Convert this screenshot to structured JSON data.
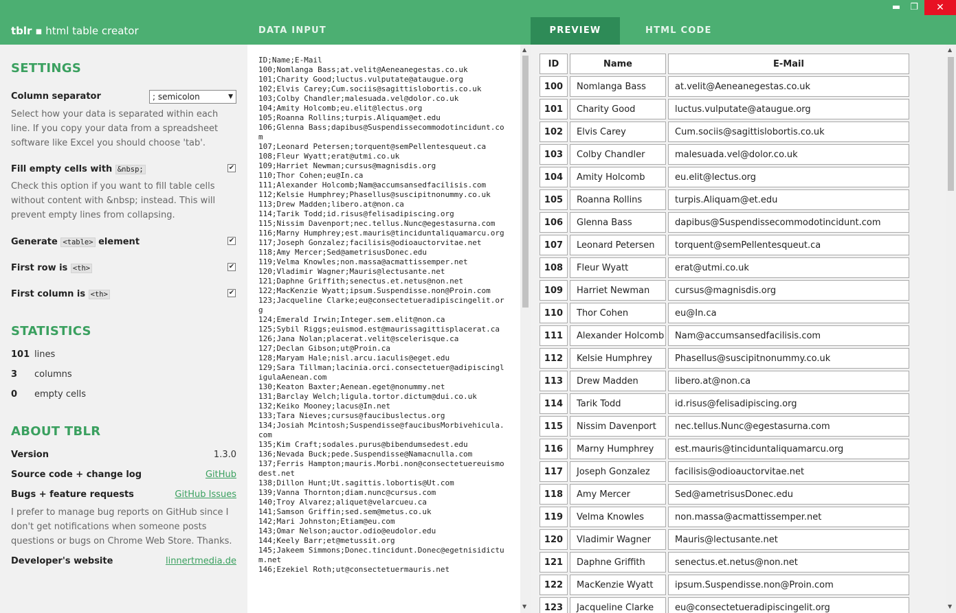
{
  "header": {
    "app_name": "tblr",
    "app_sep": "▪",
    "app_subtitle": "html table creator",
    "tab_data_input": "DATA INPUT",
    "tab_preview": "PREVIEW",
    "tab_html_code": "HTML CODE",
    "minimize": "▬",
    "maximize": "❐",
    "close": "✕"
  },
  "settings": {
    "heading": "SETTINGS",
    "separator_label": "Column separator",
    "separator_value": "; semicolon",
    "separator_desc": "Select how your data is separated within each line. If you copy your data from a spreadsheet software like Excel you should choose 'tab'.",
    "fill_label_pre": "Fill empty cells with",
    "fill_code": "&nbsp;",
    "fill_desc": "Check this option if you want to fill table cells without content with &nbsp; instead. This will prevent empty lines from collapsing.",
    "generate_pre": "Generate",
    "generate_code": "<table>",
    "generate_post": "element",
    "first_row_pre": "First row is",
    "first_row_code": "<th>",
    "first_col_pre": "First column is",
    "first_col_code": "<th>",
    "check_mark": "✔",
    "fill_checked": true,
    "generate_checked": true,
    "first_row_checked": true,
    "first_col_checked": true
  },
  "statistics": {
    "heading": "STATISTICS",
    "lines_value": "101",
    "lines_label": "lines",
    "columns_value": "3",
    "columns_label": "columns",
    "empty_value": "0",
    "empty_label": "empty cells"
  },
  "about": {
    "heading": "ABOUT TBLR",
    "version_label": "Version",
    "version_value": "1.3.0",
    "source_label": "Source code + change log",
    "source_link": "GitHub",
    "bugs_label": "Bugs + feature requests",
    "bugs_link": "GitHub Issues",
    "bugs_desc": "I prefer to manage bug reports on GitHub since I don't get notifications when someone posts questions or bugs on Chrome Web Store. Thanks.",
    "website_label": "Developer's website",
    "website_link": "linnertmedia.de"
  },
  "data_input_lines": [
    "ID;Name;E-Mail",
    "100;Nomlanga Bass;at.velit@Aeneanegestas.co.uk",
    "101;Charity Good;luctus.vulputate@ataugue.org",
    "102;Elvis Carey;Cum.sociis@sagittislobortis.co.uk",
    "103;Colby Chandler;malesuada.vel@dolor.co.uk",
    "104;Amity Holcomb;eu.elit@lectus.org",
    "105;Roanna Rollins;turpis.Aliquam@et.edu",
    "106;Glenna Bass;dapibus@Suspendissecommodotincidunt.com",
    "107;Leonard Petersen;torquent@semPellentesqueut.ca",
    "108;Fleur Wyatt;erat@utmi.co.uk",
    "109;Harriet Newman;cursus@magnisdis.org",
    "110;Thor Cohen;eu@In.ca",
    "111;Alexander Holcomb;Nam@accumsansedfacilisis.com",
    "112;Kelsie Humphrey;Phasellus@suscipitnonummy.co.uk",
    "113;Drew Madden;libero.at@non.ca",
    "114;Tarik Todd;id.risus@felisadipiscing.org",
    "115;Nissim Davenport;nec.tellus.Nunc@egestasurna.com",
    "116;Marny Humphrey;est.mauris@tinciduntaliquamarcu.org",
    "117;Joseph Gonzalez;facilisis@odioauctorvitae.net",
    "118;Amy Mercer;Sed@ametrisusDonec.edu",
    "119;Velma Knowles;non.massa@acmattissemper.net",
    "120;Vladimir Wagner;Mauris@lectusante.net",
    "121;Daphne Griffith;senectus.et.netus@non.net",
    "122;MacKenzie Wyatt;ipsum.Suspendisse.non@Proin.com",
    "123;Jacqueline Clarke;eu@consectetueradipiscingelit.org",
    "124;Emerald Irwin;Integer.sem.elit@non.ca",
    "125;Sybil Riggs;euismod.est@maurissagittisplacerat.ca",
    "126;Jana Nolan;placerat.velit@scelerisque.ca",
    "127;Declan Gibson;ut@Proin.ca",
    "128;Maryam Hale;nisl.arcu.iaculis@eget.edu",
    "129;Sara Tillman;lacinia.orci.consectetuer@adipiscingligulaAenean.com",
    "130;Keaton Baxter;Aenean.eget@nonummy.net",
    "131;Barclay Welch;ligula.tortor.dictum@dui.co.uk",
    "132;Keiko Mooney;lacus@In.net",
    "133;Tara Nieves;cursus@faucibuslectus.org",
    "134;Josiah Mcintosh;Suspendisse@faucibusMorbivehicula.com",
    "135;Kim Craft;sodales.purus@bibendumsedest.edu",
    "136;Nevada Buck;pede.Suspendisse@Namacnulla.com",
    "137;Ferris Hampton;mauris.Morbi.non@consectetuereuismodest.net",
    "138;Dillon Hunt;Ut.sagittis.lobortis@Ut.com",
    "139;Vanna Thornton;diam.nunc@cursus.com",
    "140;Troy Alvarez;aliquet@velarcueu.ca",
    "141;Samson Griffin;sed.sem@metus.co.uk",
    "142;Mari Johnston;Etiam@eu.com",
    "143;Omar Nelson;auctor.odio@eudolor.edu",
    "144;Keely Barr;et@metussit.org",
    "145;Jakeem Simmons;Donec.tincidunt.Donec@egetnisidictum.net",
    "146;Ezekiel Roth;ut@consectetuermauris.net"
  ],
  "preview": {
    "headers": [
      "ID",
      "Name",
      "E-Mail"
    ],
    "rows": [
      [
        "100",
        "Nomlanga Bass",
        "at.velit@Aeneanegestas.co.uk"
      ],
      [
        "101",
        "Charity Good",
        "luctus.vulputate@ataugue.org"
      ],
      [
        "102",
        "Elvis Carey",
        "Cum.sociis@sagittislobortis.co.uk"
      ],
      [
        "103",
        "Colby Chandler",
        "malesuada.vel@dolor.co.uk"
      ],
      [
        "104",
        "Amity Holcomb",
        "eu.elit@lectus.org"
      ],
      [
        "105",
        "Roanna Rollins",
        "turpis.Aliquam@et.edu"
      ],
      [
        "106",
        "Glenna Bass",
        "dapibus@Suspendissecommodotincidunt.com"
      ],
      [
        "107",
        "Leonard Petersen",
        "torquent@semPellentesqueut.ca"
      ],
      [
        "108",
        "Fleur Wyatt",
        "erat@utmi.co.uk"
      ],
      [
        "109",
        "Harriet Newman",
        "cursus@magnisdis.org"
      ],
      [
        "110",
        "Thor Cohen",
        "eu@In.ca"
      ],
      [
        "111",
        "Alexander Holcomb",
        "Nam@accumsansedfacilisis.com"
      ],
      [
        "112",
        "Kelsie Humphrey",
        "Phasellus@suscipitnonummy.co.uk"
      ],
      [
        "113",
        "Drew Madden",
        "libero.at@non.ca"
      ],
      [
        "114",
        "Tarik Todd",
        "id.risus@felisadipiscing.org"
      ],
      [
        "115",
        "Nissim Davenport",
        "nec.tellus.Nunc@egestasurna.com"
      ],
      [
        "116",
        "Marny Humphrey",
        "est.mauris@tinciduntaliquamarcu.org"
      ],
      [
        "117",
        "Joseph Gonzalez",
        "facilisis@odioauctorvitae.net"
      ],
      [
        "118",
        "Amy Mercer",
        "Sed@ametrisusDonec.edu"
      ],
      [
        "119",
        "Velma Knowles",
        "non.massa@acmattissemper.net"
      ],
      [
        "120",
        "Vladimir Wagner",
        "Mauris@lectusante.net"
      ],
      [
        "121",
        "Daphne Griffith",
        "senectus.et.netus@non.net"
      ],
      [
        "122",
        "MacKenzie Wyatt",
        "ipsum.Suspendisse.non@Proin.com"
      ],
      [
        "123",
        "Jacqueline Clarke",
        "eu@consectetueradipiscingelit.org"
      ]
    ]
  },
  "colors": {
    "header_green": "#4caf72",
    "active_tab": "#2e8b57",
    "heading_green": "#3aa05f",
    "close_red": "#e81123"
  }
}
